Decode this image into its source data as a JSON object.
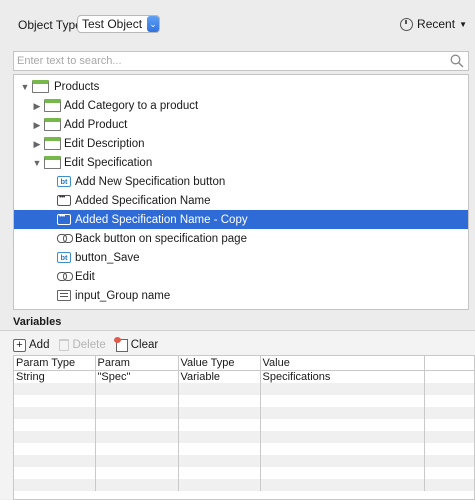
{
  "header": {
    "object_type_label": "Object Type",
    "object_type_value": "Test Object",
    "recent_label": "Recent"
  },
  "search": {
    "placeholder": "Enter text to search..."
  },
  "tree": {
    "root": {
      "label": "Products",
      "expanded": true
    },
    "folders": [
      {
        "label": "Add Category to a product",
        "expanded": false
      },
      {
        "label": "Add Product",
        "expanded": false
      },
      {
        "label": "Edit Description",
        "expanded": false
      },
      {
        "label": "Edit Specification",
        "expanded": true
      }
    ],
    "items": [
      {
        "label": "Add New Specification button",
        "icon": "bt-button-icon",
        "selected": false
      },
      {
        "label": "Added Specification Name",
        "icon": "element-icon",
        "selected": false
      },
      {
        "label": "Added Specification Name - Copy",
        "icon": "element-icon",
        "selected": true
      },
      {
        "label": "Back button on specification page",
        "icon": "link-icon",
        "selected": false
      },
      {
        "label": "button_Save",
        "icon": "bt-button-icon",
        "selected": false
      },
      {
        "label": "Edit",
        "icon": "link-icon",
        "selected": false
      },
      {
        "label": "input_Group name",
        "icon": "input-icon",
        "selected": false
      }
    ],
    "bt_badge": "bt"
  },
  "variables": {
    "title": "Variables",
    "toolbar": {
      "add": "Add",
      "delete": "Delete",
      "clear": "Clear"
    },
    "columns": [
      "Param Type",
      "Param",
      "Value Type",
      "Value"
    ],
    "rows": [
      [
        "String",
        "\"Spec\"",
        "Variable",
        "Specifications"
      ]
    ]
  },
  "colors": {
    "selection": "#2e6bd6",
    "folder_tab": "#77b84a",
    "accent": "#2f73e0"
  }
}
